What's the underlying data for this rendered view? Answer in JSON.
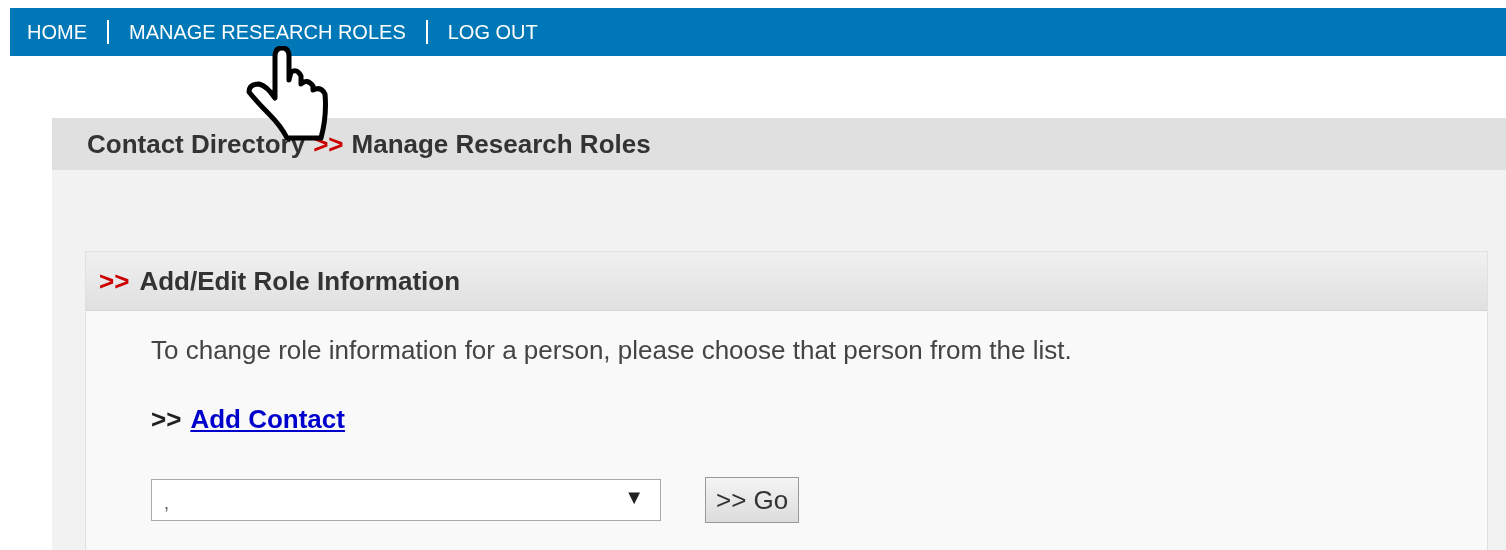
{
  "nav": {
    "items": [
      {
        "label": "HOME"
      },
      {
        "label": "MANAGE RESEARCH ROLES"
      },
      {
        "label": "LOG OUT"
      }
    ]
  },
  "breadcrumb": {
    "items": [
      "Contact Directory",
      "Manage Research Roles"
    ],
    "separator": ">>"
  },
  "panel": {
    "marker": ">>",
    "title": "Add/Edit Role Information",
    "instructions": "To change role information for a person, please choose that person from the list.",
    "add_link": {
      "marker": ">>",
      "label": "Add Contact"
    },
    "select": {
      "value": ",",
      "caret": "▼"
    },
    "go_button": ">> Go"
  }
}
